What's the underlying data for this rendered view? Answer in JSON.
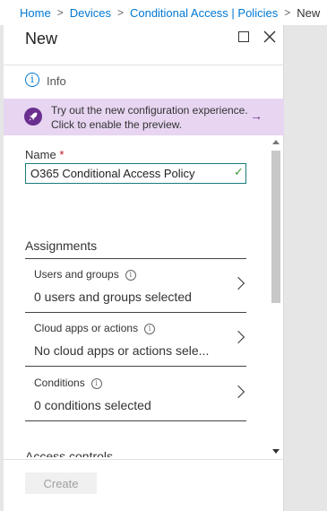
{
  "breadcrumb": {
    "items": [
      "Home",
      "Devices",
      "Conditional Access | Policies"
    ],
    "current": "New",
    "separator": ">"
  },
  "blade": {
    "title": "New"
  },
  "info": {
    "label": "Info"
  },
  "preview_banner": {
    "text": "Try out the new configuration experience. Click to enable the preview.",
    "arrow": "→"
  },
  "name_field": {
    "label": "Name",
    "required_marker": "*",
    "value": "O365 Conditional Access Policy",
    "valid_mark": "✓"
  },
  "assignments": {
    "heading": "Assignments",
    "rows": [
      {
        "title": "Users and groups",
        "value": "0 users and groups selected"
      },
      {
        "title": "Cloud apps or actions",
        "value": "No cloud apps or actions sele..."
      },
      {
        "title": "Conditions",
        "value": "0 conditions selected"
      }
    ]
  },
  "access_controls": {
    "heading": "Access controls"
  },
  "footer": {
    "create_label": "Create",
    "create_enabled": false
  },
  "colors": {
    "link": "#0078d4",
    "banner_bg": "#e7d5f1",
    "banner_accent": "#6b2f8f",
    "valid": "#3c9b3c",
    "required": "#c50f1f"
  },
  "icons": {
    "info": "info-icon",
    "rocket": "rocket-icon",
    "maximize": "maximize-icon",
    "close": "close-icon",
    "chevron": "chevron-right-icon"
  }
}
